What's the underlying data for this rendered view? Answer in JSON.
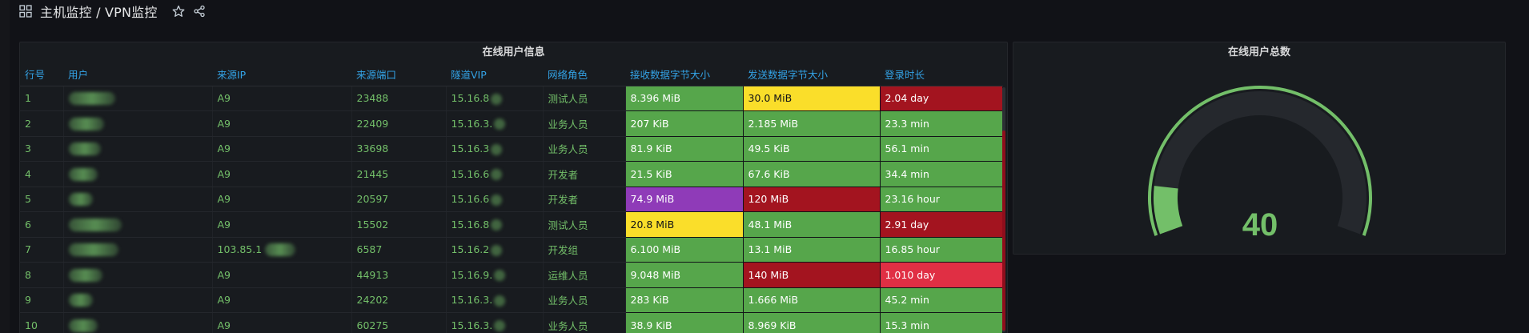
{
  "header": {
    "breadcrumb": "主机监控 / VPN监控"
  },
  "table_panel": {
    "title": "在线用户信息",
    "columns": [
      "行号",
      "用户",
      "来源IP",
      "来源端口",
      "隧道VIP",
      "网络角色",
      "接收数据字节大小",
      "发送数据字节大小",
      "登录时长"
    ],
    "rows": [
      {
        "idx": "1",
        "user": "",
        "src_ip": "A9",
        "port": "23488",
        "vip": "15.16.8",
        "role": "测试人员",
        "recv": "8.396 MiB",
        "sent": "30.0 MiB",
        "duration": "2.04 day"
      },
      {
        "idx": "2",
        "user": "",
        "src_ip": "A9",
        "port": "22409",
        "vip": "15.16.3.",
        "role": "业务人员",
        "recv": "207 KiB",
        "sent": "2.185 MiB",
        "duration": "23.3 min"
      },
      {
        "idx": "3",
        "user": "",
        "src_ip": "A9",
        "port": "33698",
        "vip": "15.16.3",
        "role": "业务人员",
        "recv": "81.9 KiB",
        "sent": "49.5 KiB",
        "duration": "56.1 min"
      },
      {
        "idx": "4",
        "user": "",
        "src_ip": "A9",
        "port": "21445",
        "vip": "15.16.6",
        "role": "开发者",
        "recv": "21.5 KiB",
        "sent": "67.6 KiB",
        "duration": "34.4 min"
      },
      {
        "idx": "5",
        "user": "",
        "src_ip": "A9",
        "port": "20597",
        "vip": "15.16.6",
        "role": "开发者",
        "recv": "74.9 MiB",
        "sent": "120 MiB",
        "duration": "23.16 hour"
      },
      {
        "idx": "6",
        "user": "",
        "src_ip": "A9",
        "port": "15502",
        "vip": "15.16.8",
        "role": "测试人员",
        "recv": "20.8 MiB",
        "sent": "48.1 MiB",
        "duration": "2.91 day"
      },
      {
        "idx": "7",
        "user": "",
        "src_ip": "103.85.1",
        "port": "6587",
        "vip": "15.16.2",
        "role": "开发组",
        "recv": "6.100 MiB",
        "sent": "13.1 MiB",
        "duration": "16.85 hour"
      },
      {
        "idx": "8",
        "user": "",
        "src_ip": "A9",
        "port": "44913",
        "vip": "15.16.9.",
        "role": "运维人员",
        "recv": "9.048 MiB",
        "sent": "140 MiB",
        "duration": "1.010 day"
      },
      {
        "idx": "9",
        "user": "",
        "src_ip": "A9",
        "port": "24202",
        "vip": "15.16.3.",
        "role": "业务人员",
        "recv": "283 KiB",
        "sent": "1.666 MiB",
        "duration": "45.2 min"
      },
      {
        "idx": "10",
        "user": "",
        "src_ip": "A9",
        "port": "60275",
        "vip": "15.16.3.",
        "role": "业务人员",
        "recv": "38.9 KiB",
        "sent": "8.969 KiB",
        "duration": "15.3 min"
      }
    ],
    "cell_colors": {
      "recv": [
        "green",
        "green",
        "green",
        "green",
        "purple",
        "yellow",
        "green",
        "green",
        "green",
        "green"
      ],
      "sent": [
        "yellow",
        "green",
        "green",
        "green",
        "red",
        "green",
        "green",
        "red",
        "green",
        "green"
      ],
      "duration": [
        "red",
        "green",
        "green",
        "green",
        "green",
        "red",
        "green",
        "bright-red",
        "green",
        "green"
      ]
    },
    "palette": {
      "green": "#56a64b",
      "yellow": "#fade2a",
      "red": "#a3141f",
      "bright-red": "#e02f44",
      "purple": "#8f3bb8",
      "header_text": "#33a2e5",
      "body_text": "#73bf69"
    }
  },
  "gauge_panel": {
    "title": "在线用户总数",
    "value": "40",
    "fill_fraction": 0.12,
    "color": "#73bf69",
    "track_color": "#25282d"
  }
}
